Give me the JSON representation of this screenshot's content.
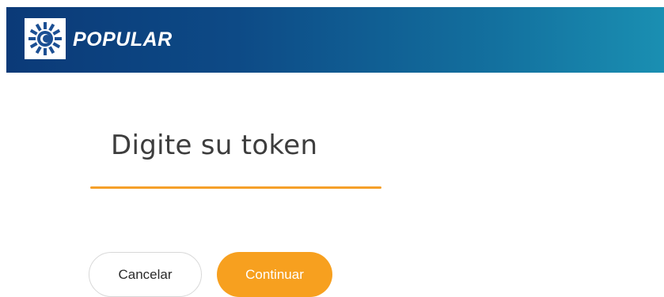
{
  "header": {
    "brand_name": "POPULAR",
    "logo_icon": "popular-sun-logo",
    "gradient_colors": [
      "#0b3a78",
      "#1a8fb2"
    ]
  },
  "token": {
    "placeholder": "Digite su token",
    "accent_color": "#f5a02a"
  },
  "actions": {
    "cancel_label": "Cancelar",
    "continue_label": "Continuar",
    "continue_color": "#f7a01f"
  }
}
